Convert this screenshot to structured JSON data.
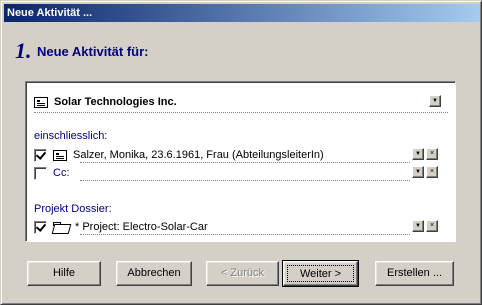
{
  "window": {
    "title": "Neue Aktivität ..."
  },
  "step": {
    "number": "1.",
    "heading": "Neue Aktivität für:"
  },
  "panel": {
    "company": "Solar Technologies Inc.",
    "inclusive_label": "einschliesslich:",
    "contact": {
      "checked": true,
      "text": "Salzer, Monika, 23.6.1961, Frau  (AbteilungsleiterIn)"
    },
    "cc": {
      "checked": false,
      "text": "Cc:"
    },
    "dossier_label": "Projekt Dossier:",
    "project": {
      "checked": true,
      "text": "* Project: Electro-Solar-Car"
    }
  },
  "icons": {
    "dropdown": "▼",
    "remove": "×"
  },
  "buttons": {
    "help": "Hilfe",
    "cancel": "Abbrechen",
    "back": "< Zurück",
    "next": "Weiter >",
    "create": "Erstellen ..."
  }
}
